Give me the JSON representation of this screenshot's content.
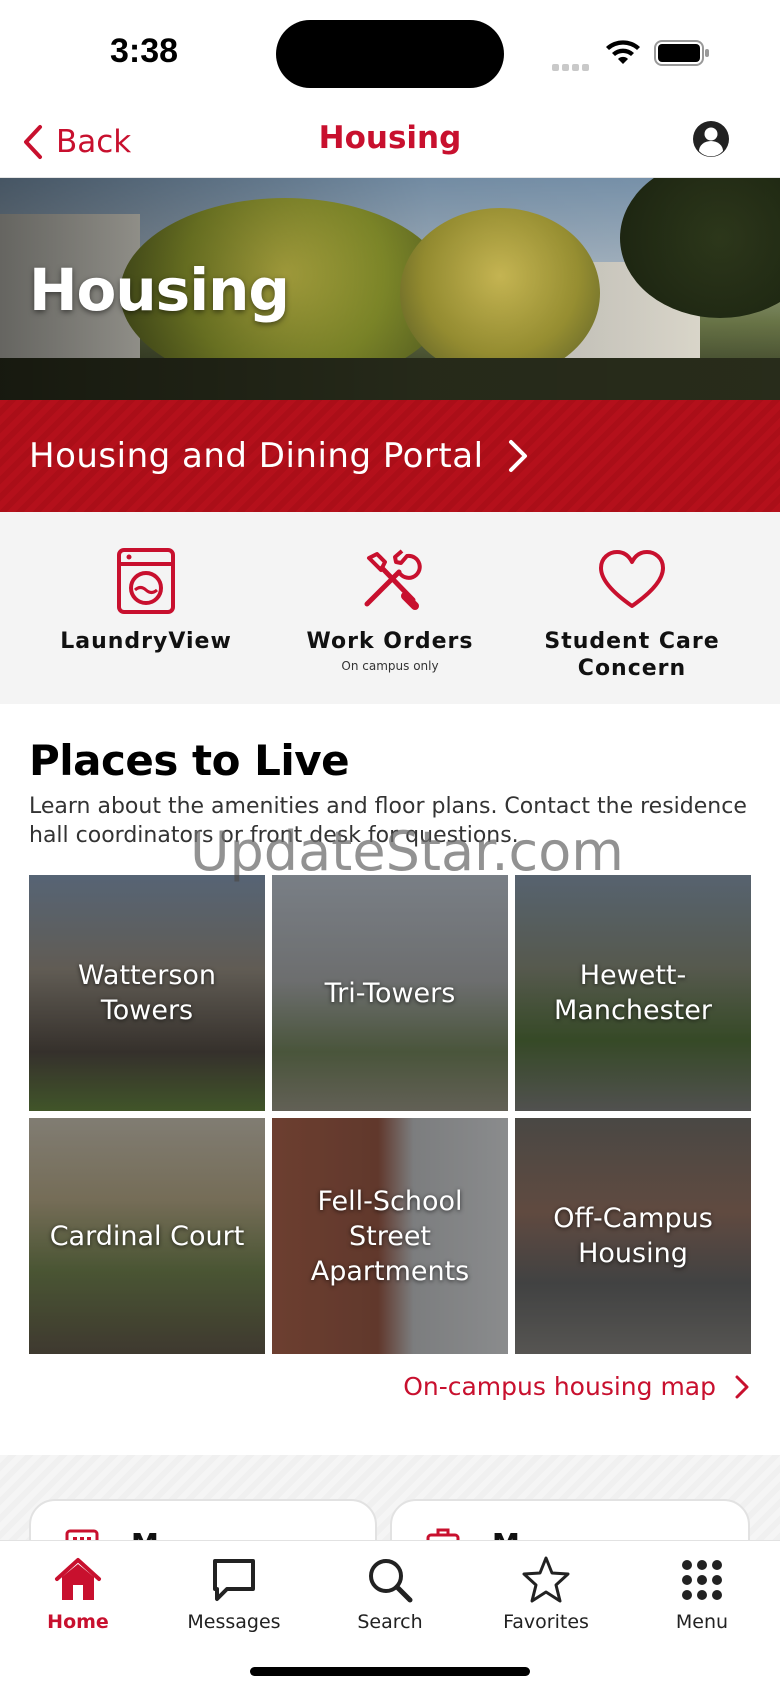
{
  "status_bar": {
    "time": "3:38"
  },
  "nav": {
    "back_label": "Back",
    "title": "Housing"
  },
  "hero": {
    "title": "Housing"
  },
  "portal": {
    "label": "Housing and Dining Portal"
  },
  "quick_links": [
    {
      "label": "LaundryView",
      "sublabel": "",
      "icon": "washing-machine-icon"
    },
    {
      "label": "Work Orders",
      "sublabel": "On campus only",
      "icon": "wrench-screwdriver-icon"
    },
    {
      "label": "Student Care Concern",
      "sublabel": "",
      "icon": "heart-icon"
    }
  ],
  "places": {
    "title": "Places to Live",
    "description": "Learn about the amenities and floor plans. Contact the residence hall coordinators or front desk for questions.",
    "tiles": [
      {
        "label": "Watterson Towers"
      },
      {
        "label": "Tri-Towers"
      },
      {
        "label": "Hewett-Manchester"
      },
      {
        "label": "Cardinal Court"
      },
      {
        "label": "Fell-School Street Apartments"
      },
      {
        "label": "Off-Campus Housing"
      }
    ],
    "map_link": "On-campus housing map"
  },
  "lower_cards": [
    {
      "label": "M",
      "icon": "calendar-icon"
    },
    {
      "label": "M",
      "icon": "briefcase-icon"
    }
  ],
  "tabbar": {
    "tabs": [
      {
        "label": "Home",
        "icon": "home-icon",
        "active": true
      },
      {
        "label": "Messages",
        "icon": "chat-icon",
        "active": false
      },
      {
        "label": "Search",
        "icon": "search-icon",
        "active": false
      },
      {
        "label": "Favorites",
        "icon": "star-icon",
        "active": false
      },
      {
        "label": "Menu",
        "icon": "grid-menu-icon",
        "active": false
      }
    ]
  },
  "watermark": "UpdateStar.com",
  "colors": {
    "accent": "#c8102e",
    "banner": "#b4101b",
    "quick_bg": "#f4f4f4"
  }
}
